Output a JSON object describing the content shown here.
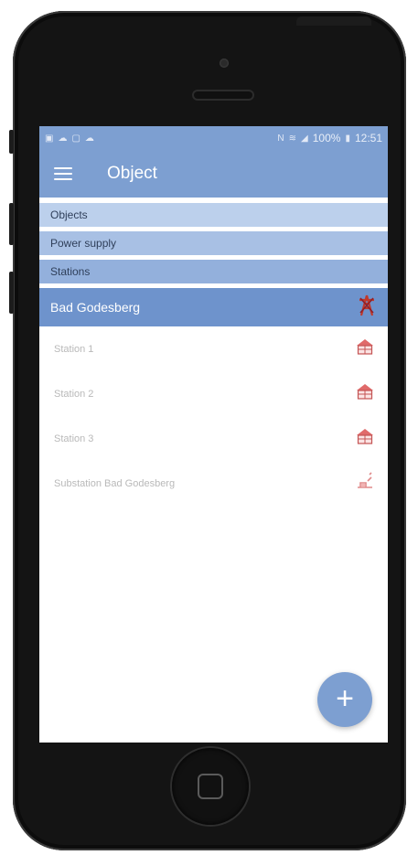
{
  "status_bar": {
    "left_icons": [
      "image-icon",
      "cloud-icon",
      "phone-icon",
      "cloud-icon"
    ],
    "battery": "100%",
    "time": "12:51"
  },
  "app_bar": {
    "title": "Object",
    "menu_icon": "hamburger-menu-icon"
  },
  "breadcrumbs": [
    {
      "label": "Objects"
    },
    {
      "label": "Power supply"
    },
    {
      "label": "Stations"
    }
  ],
  "group": {
    "title": "Bad Godesberg",
    "icon": "power-pylon-icon"
  },
  "items": [
    {
      "label": "Station 1",
      "icon": "station-house-icon"
    },
    {
      "label": "Station 2",
      "icon": "station-house-icon"
    },
    {
      "label": "Station 3",
      "icon": "station-house-icon"
    },
    {
      "label": "Substation Bad Godesberg",
      "icon": "substation-icon"
    }
  ],
  "fab": {
    "label": "+",
    "icon": "add-icon"
  },
  "colors": {
    "primary": "#7d9fd1",
    "group_header": "#6e93cc",
    "station_icon": "#e06a6a"
  }
}
